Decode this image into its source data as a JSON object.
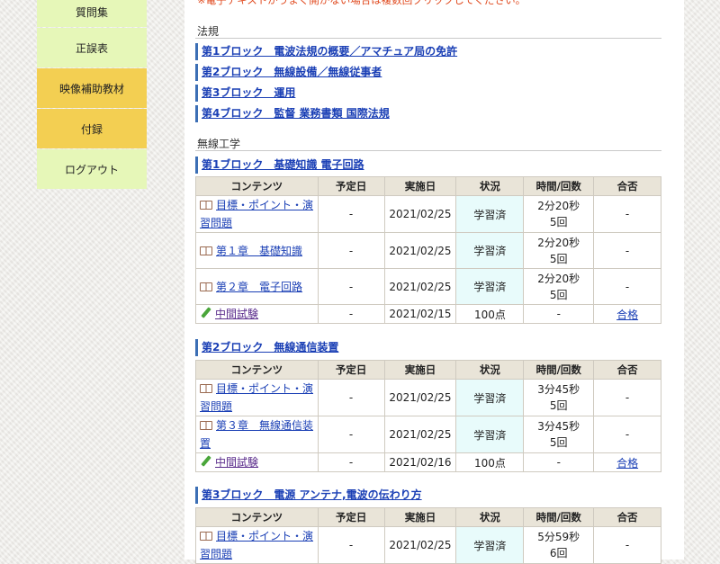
{
  "sidebar": {
    "items": [
      {
        "label": "質問集",
        "color": "#e6f7b8"
      },
      {
        "label": "正誤表",
        "color": "#e6f7b8"
      },
      {
        "label": "映像補助教材",
        "color": "#f3cf52"
      },
      {
        "label": "付録",
        "color": "#f3cf52"
      },
      {
        "label": "ログアウト",
        "color": "#e6f7b8"
      }
    ]
  },
  "top_note": "※電子テキストがうまく開かない場合は複数回クリックしてください。",
  "hoki": {
    "title": "法規",
    "links": [
      "第1ブロック　電波法規の概要／アマチュア局の免許",
      "第2ブロック　無線設備／無線従事者",
      "第3ブロック　運用",
      "第4ブロック　監督 業務書類 国際法規"
    ]
  },
  "musen": {
    "title": "無線工学",
    "headers": [
      "コンテンツ",
      "予定日",
      "実施日",
      "状況",
      "時間/回数",
      "合否"
    ],
    "blocks": [
      {
        "title": "第1ブロック　基礎知識 電子回路",
        "rows": [
          {
            "content": "目標・ポイント・演習問題",
            "icon": "book",
            "scheduled": "-",
            "done": "2021/02/25",
            "status": "学習済",
            "time": "2分20秒",
            "count": "5回",
            "result": "-"
          },
          {
            "content": "第１章　基礎知識",
            "icon": "book",
            "scheduled": "-",
            "done": "2021/02/25",
            "status": "学習済",
            "time": "2分20秒",
            "count": "5回",
            "result": "-"
          },
          {
            "content": "第２章　電子回路",
            "icon": "book",
            "scheduled": "-",
            "done": "2021/02/25",
            "status": "学習済",
            "time": "2分20秒",
            "count": "5回",
            "result": "-"
          },
          {
            "content": "中間試験",
            "icon": "pencil",
            "scheduled": "-",
            "done": "2021/02/15",
            "status": "100点",
            "time": "-",
            "count": "",
            "result": "合格"
          }
        ]
      },
      {
        "title": "第2ブロック　無線通信装置",
        "rows": [
          {
            "content": "目標・ポイント・演習問題",
            "icon": "book",
            "scheduled": "-",
            "done": "2021/02/25",
            "status": "学習済",
            "time": "3分45秒",
            "count": "5回",
            "result": "-"
          },
          {
            "content": "第３章　無線通信装置",
            "icon": "book",
            "scheduled": "-",
            "done": "2021/02/25",
            "status": "学習済",
            "time": "3分45秒",
            "count": "5回",
            "result": "-"
          },
          {
            "content": "中間試験",
            "icon": "pencil",
            "scheduled": "-",
            "done": "2021/02/16",
            "status": "100点",
            "time": "-",
            "count": "",
            "result": "合格"
          }
        ]
      },
      {
        "title": "第3ブロック　電源 アンテナ,電波の伝わり方",
        "rows": [
          {
            "content": "目標・ポイント・演習問題",
            "icon": "book",
            "scheduled": "-",
            "done": "2021/02/25",
            "status": "学習済",
            "time": "5分59秒",
            "count": "6回",
            "result": "-"
          }
        ]
      }
    ]
  }
}
